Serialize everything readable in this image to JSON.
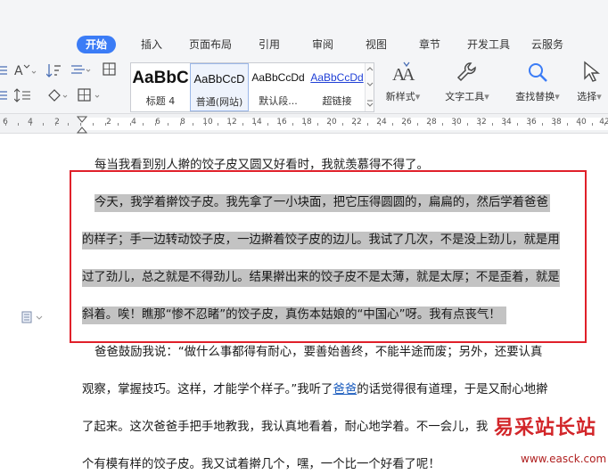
{
  "tabs": [
    {
      "label": "开始",
      "active": true
    },
    {
      "label": "插入"
    },
    {
      "label": "页面布局"
    },
    {
      "label": "引用"
    },
    {
      "label": "审阅"
    },
    {
      "label": "视图"
    },
    {
      "label": "章节"
    },
    {
      "label": "开发工具"
    },
    {
      "label": "云服务"
    }
  ],
  "ribbon": {
    "styles": [
      {
        "sample": "AaBbC",
        "caption": "标题 4"
      },
      {
        "sample": "AaBbCcD",
        "caption": "普通(网站)"
      },
      {
        "sample": "AaBbCcDd",
        "caption": "默认段..."
      },
      {
        "sample": "AaBbCcDd",
        "caption": "超链接"
      }
    ],
    "new_style_label": "新样式",
    "text_tools_label": "文字工具",
    "find_replace_label": "查找替换",
    "select_label": "选择",
    "dropdown_glyph": "▾"
  },
  "ruler": {
    "numbers": [
      "6",
      "4",
      "2",
      "2",
      "4",
      "6",
      "8",
      "10",
      "12",
      "14",
      "16",
      "18",
      "20",
      "22",
      "24",
      "26",
      "28",
      "30",
      "32",
      "34",
      "36",
      "38",
      "40",
      "42"
    ]
  },
  "document": {
    "lines": [
      "每当我看到别人擀的饺子皮又圆又好看时，我就羡慕得不得了。",
      "今天，我学着擀饺子皮。我先拿了一小块面，把它压得圆圆的，扁扁的，然后学着爸爸",
      "的样子；手一边转动饺子皮，一边擀着饺子皮的边儿。我试了几次，不是没上劲儿，就是用",
      "过了劲儿，总之就是不得劲儿。结果擀出来的饺子皮不是太薄，就是太厚；不是歪着，就是",
      "斜着。唉！瞧那“惨不忍睹”的饺子皮，真伤本姑娘的“中国心”呀。我有点丧气！",
      "爸爸鼓励我说：“做什么事都得有耐心，要善始善终，不能半途而废；另外，还要认真",
      "观察，掌握技巧。这样，才能学个样子。”我听了",
      "爸爸",
      "的话觉得很有道理，于是又耐心地擀",
      "了起来。这次爸爸手把手地教我，我认真地看着，耐心地学着。不一会儿，我",
      "个有模有样的饺子皮。我又试着擀几个，嘿，一个比一个好看了呢！"
    ]
  },
  "watermark": {
    "brand": "易采站长站",
    "url": "www.easck.com"
  },
  "colors": {
    "accent": "#3b7cf6",
    "selection": "#c3c3c3",
    "highlight_box": "#e0202a",
    "link": "#1f5fbf"
  }
}
